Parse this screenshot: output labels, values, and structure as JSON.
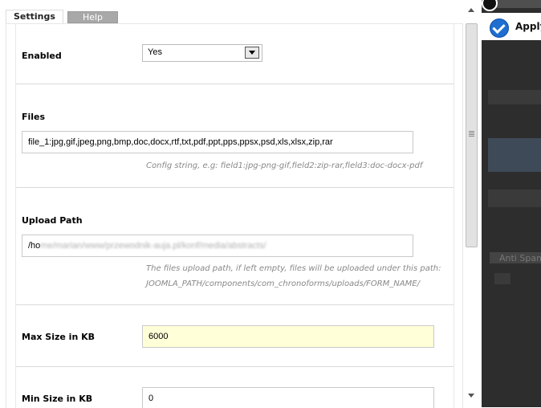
{
  "tabs": [
    {
      "label": "Settings",
      "active": true
    },
    {
      "label": "Help",
      "active": false
    }
  ],
  "fields": {
    "enabled": {
      "label": "Enabled",
      "value": "Yes"
    },
    "files": {
      "label": "Files",
      "value": "file_1:jpg,gif,jpeg,png,bmp,doc,docx,rtf,txt,pdf,ppt,pps,ppsx,psd,xls,xlsx,zip,rar",
      "hint": "Config string, e.g: field1:jpg-png-gif,field2:zip-rar,field3:doc-docx-pdf"
    },
    "upload_path": {
      "label": "Upload Path",
      "value_visible": "/ho",
      "value_blurred": "me/marian/www/przewodnik-auja.pl/konf/media/abstracts/",
      "hint_line1": "The files upload path, if left empty, files will be uploaded under this path:",
      "hint_line2": "JOOMLA_PATH/components/com_chronoforms/uploads/FORM_NAME/"
    },
    "max_size": {
      "label": "Max Size in KB",
      "value": "6000"
    },
    "min_size": {
      "label": "Min Size in KB",
      "value": "0"
    }
  },
  "background": {
    "apply_label": "Apply",
    "blurred_text": "Anti Spam"
  },
  "colors": {
    "highlight_input": "#ffffd8",
    "apply_icon": "#1f6fd1",
    "inactive_tab": "#a8a8a8"
  },
  "icons": {
    "apply": "checkmark-circle-icon",
    "select_arrow": "chevron-down-icon"
  }
}
